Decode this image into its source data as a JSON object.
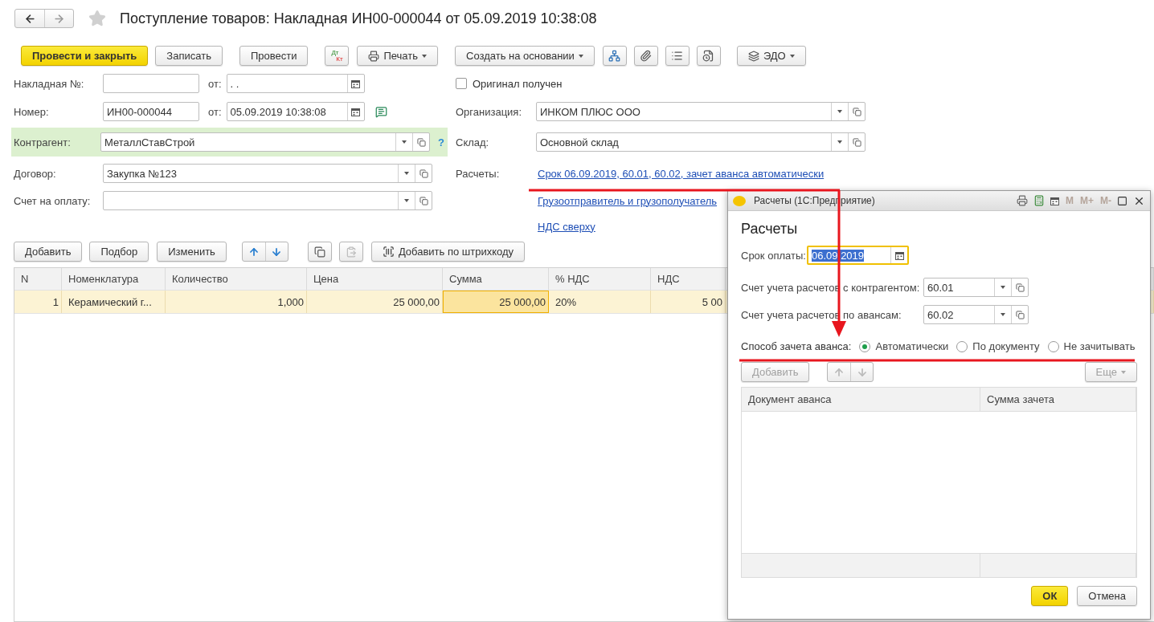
{
  "page": {
    "title": "Поступление товаров: Накладная ИН00-000044 от 05.09.2019 10:38:08",
    "favorite": false
  },
  "toolbar": [
    {
      "kind": "primary",
      "label": "Провести и закрыть"
    },
    {
      "kind": "button",
      "label": "Записать"
    },
    {
      "kind": "button",
      "label": "Провести"
    },
    {
      "kind": "dtkt",
      "top": "Дт",
      "bottom": "Кт"
    },
    {
      "kind": "menu",
      "label": "Печать"
    },
    {
      "kind": "menu",
      "label": "Создать на основании"
    },
    {
      "kind": "icon"
    },
    {
      "kind": "icon"
    },
    {
      "kind": "icon"
    },
    {
      "kind": "icon"
    },
    {
      "kind": "menu",
      "label": "ЭДО"
    }
  ],
  "fields_left": [
    {
      "kind": "number_date",
      "label": "Накладная №:",
      "date_label": "от:",
      "date": ".  ."
    },
    {
      "kind": "number_date",
      "label": "Номер:",
      "value": "ИН00-000044",
      "date_label": "от:",
      "date": "05.09.2019 10:38:08"
    },
    {
      "kind": "select",
      "label": "Контрагент:",
      "value": "МеталлСтавСтрой",
      "highlighted": true,
      "help": "?"
    },
    {
      "kind": "select",
      "label": "Договор:",
      "value": "Закупка №123",
      "highlighted": false
    },
    {
      "kind": "select",
      "label": "Счет на оплату:",
      "highlighted": false
    }
  ],
  "fields_right": [
    {
      "kind": "checkbox",
      "label": "Оригинал получен",
      "checked": false
    },
    {
      "kind": "select",
      "label": "Организация:",
      "value": "ИНКОМ ПЛЮС ООО"
    },
    {
      "kind": "select",
      "label": "Склад:",
      "value": "Основной склад"
    },
    {
      "kind": "link",
      "label": "Расчеты:",
      "value": "Срок 06.09.2019, 60.01, 60.02, зачет аванса автоматически"
    },
    {
      "kind": "link",
      "value": "Грузоотправитель и грузополучатель"
    },
    {
      "kind": "link",
      "value": "НДС сверху"
    }
  ],
  "table_toolbar": [
    {
      "kind": "button",
      "label": "Добавить"
    },
    {
      "kind": "button",
      "label": "Подбор"
    },
    {
      "kind": "button",
      "label": "Изменить"
    },
    {
      "kind": "arrows"
    },
    {
      "kind": "icon",
      "disabled": false
    },
    {
      "kind": "icon",
      "disabled": true
    },
    {
      "kind": "icon_button",
      "label": "Добавить по штрихкоду"
    }
  ],
  "table": {
    "columns": [
      "N",
      "Номенклатура",
      "Количество",
      "Цена",
      "Сумма",
      "% НДС",
      "НДС"
    ],
    "rows": [
      {
        "selected": true,
        "cells": [
          {
            "text": "1",
            "current": false
          },
          {
            "text": "Керамический г...",
            "current": false
          },
          {
            "text": "1,000",
            "current": false
          },
          {
            "text": "25 000,00",
            "current": false
          },
          {
            "text": "25 000,00",
            "current": true
          },
          {
            "text": "20%",
            "current": false
          },
          {
            "text": "5 00",
            "current": false
          }
        ]
      }
    ]
  },
  "dialog": {
    "window_title": "Расчеты  (1С:Предприятие)",
    "memory_buttons": [
      "M",
      "M+",
      "M-"
    ],
    "heading": "Расчеты",
    "due_date": {
      "label": "Срок оплаты:",
      "value": "06.09.2019",
      "text_selected": true
    },
    "accounts": [
      {
        "label": "Счет учета расчетов с контрагентом:",
        "value": "60.01"
      },
      {
        "label": "Счет учета расчетов по авансам:",
        "value": "60.02"
      }
    ],
    "offset": {
      "label": "Способ зачета аванса:",
      "options": [
        {
          "label": "Автоматически",
          "selected": true
        },
        {
          "label": "По документу",
          "selected": false
        },
        {
          "label": "Не зачитывать",
          "selected": false
        }
      ]
    },
    "toolbar": {
      "add": {
        "label": "Добавить",
        "disabled": true
      },
      "arrows_disabled": true,
      "more": {
        "label": "Еще",
        "disabled": true
      }
    },
    "table": {
      "columns": [
        "Документ аванса",
        "Сумма зачета"
      ]
    },
    "buttons": [
      {
        "kind": "default",
        "label": "ОК"
      },
      {
        "kind": "button",
        "label": "Отмена"
      }
    ]
  }
}
